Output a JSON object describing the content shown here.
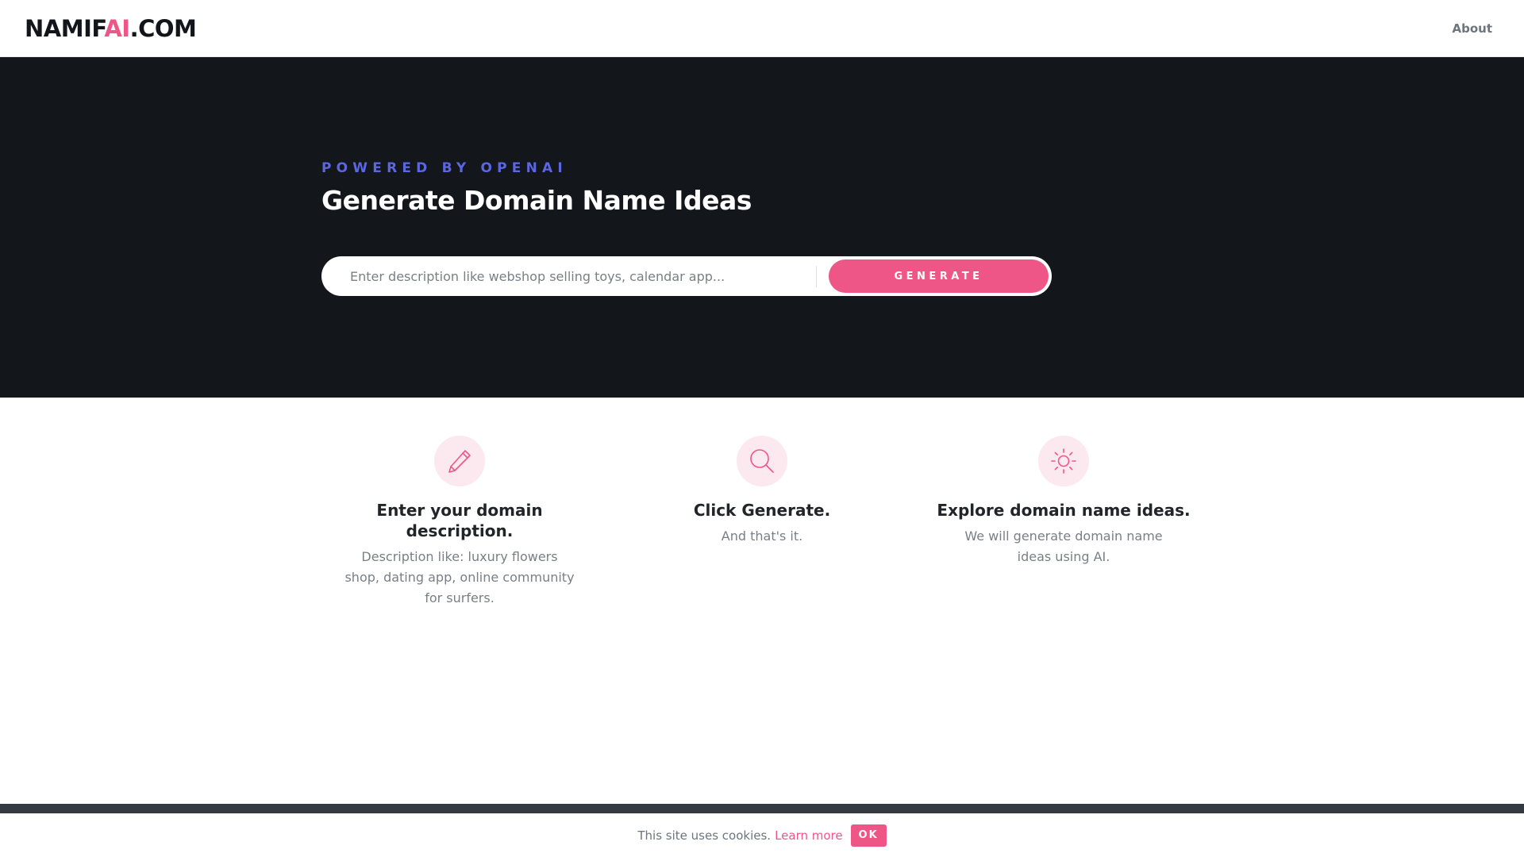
{
  "nav": {
    "logo_main": "NAMIF",
    "logo_accent": "AI",
    "logo_tail": ".COM",
    "about_label": "About"
  },
  "hero": {
    "eyebrow": "POWERED BY OPENAI",
    "title": "Generate Domain Name Ideas",
    "search_placeholder": "Enter description like webshop selling toys, calendar app...",
    "search_value": "",
    "generate_label": "GENERATE"
  },
  "features": [
    {
      "icon": "pencil-icon",
      "title": "Enter your domain description.",
      "description": "Description like: luxury flowers shop, dating app, online community for surfers."
    },
    {
      "icon": "search-icon",
      "title": "Click Generate.",
      "description": "And that's it."
    },
    {
      "icon": "sun-icon",
      "title": "Explore domain name ideas.",
      "description": "We will generate domain name ideas using AI."
    }
  ],
  "cookie": {
    "text": "This site uses cookies.",
    "link_label": "Learn more",
    "ok_label": "OK"
  },
  "colors": {
    "accent": "#ee5688",
    "eyebrow": "#5a67e0",
    "hero_bg": "#13161a",
    "footer_strip": "#353a41",
    "icon_bg": "#fce8ef"
  }
}
